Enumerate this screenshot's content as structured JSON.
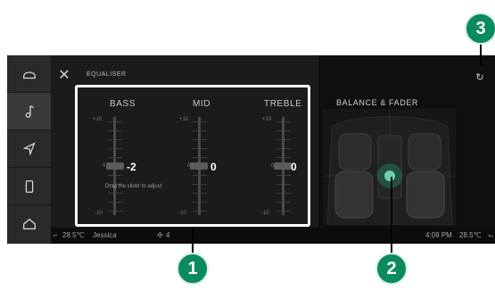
{
  "header": {
    "close_label": "✕",
    "title": "EQUALISER"
  },
  "sidebar": {
    "items": [
      {
        "name": "vehicle",
        "icon": "car-shape-icon"
      },
      {
        "name": "media",
        "icon": "music-note-icon"
      },
      {
        "name": "navigation",
        "icon": "navigation-arrow-icon"
      },
      {
        "name": "phone",
        "icon": "phone-icon"
      },
      {
        "name": "home",
        "icon": "home-icon"
      }
    ]
  },
  "equaliser": {
    "bands": [
      {
        "label": "BASS",
        "value": "-2",
        "top_scale": "+10",
        "mid_scale": "0",
        "bottom_scale": "-10"
      },
      {
        "label": "MID",
        "value": "0",
        "top_scale": "+10",
        "mid_scale": "0",
        "bottom_scale": "-10"
      },
      {
        "label": "TREBLE",
        "value": "0",
        "top_scale": "+10",
        "mid_scale": "0",
        "bottom_scale": "-10"
      }
    ],
    "hint": "Drag the slider to adjust"
  },
  "balance_fader": {
    "title": "BALANCE & FADER"
  },
  "reset_icon": "reset-icon",
  "status_bar": {
    "left_temp": "28.5℃",
    "user": "Jessica",
    "fan": "4",
    "time": "4:09 PM",
    "right_temp": "28.5℃"
  },
  "callouts": {
    "one": "1",
    "two": "2",
    "three": "3"
  },
  "colors": {
    "callout_green": "#0b8a5b",
    "highlight": "#ffffff",
    "background": "#121212"
  }
}
